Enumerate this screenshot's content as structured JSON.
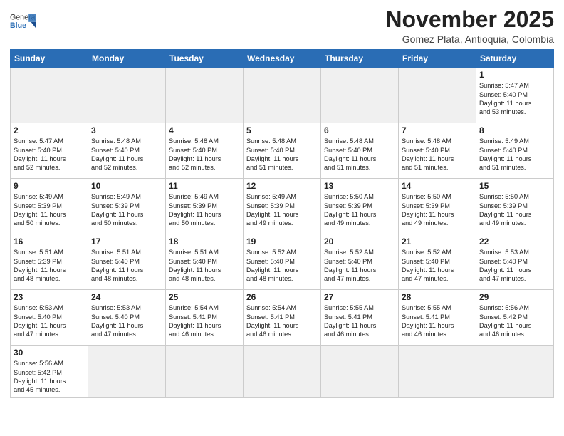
{
  "header": {
    "logo_general": "General",
    "logo_blue": "Blue",
    "month": "November 2025",
    "location": "Gomez Plata, Antioquia, Colombia"
  },
  "weekdays": [
    "Sunday",
    "Monday",
    "Tuesday",
    "Wednesday",
    "Thursday",
    "Friday",
    "Saturday"
  ],
  "weeks": [
    [
      {
        "day": "",
        "info": ""
      },
      {
        "day": "",
        "info": ""
      },
      {
        "day": "",
        "info": ""
      },
      {
        "day": "",
        "info": ""
      },
      {
        "day": "",
        "info": ""
      },
      {
        "day": "",
        "info": ""
      },
      {
        "day": "1",
        "info": "Sunrise: 5:47 AM\nSunset: 5:40 PM\nDaylight: 11 hours\nand 53 minutes."
      }
    ],
    [
      {
        "day": "2",
        "info": "Sunrise: 5:47 AM\nSunset: 5:40 PM\nDaylight: 11 hours\nand 52 minutes."
      },
      {
        "day": "3",
        "info": "Sunrise: 5:48 AM\nSunset: 5:40 PM\nDaylight: 11 hours\nand 52 minutes."
      },
      {
        "day": "4",
        "info": "Sunrise: 5:48 AM\nSunset: 5:40 PM\nDaylight: 11 hours\nand 52 minutes."
      },
      {
        "day": "5",
        "info": "Sunrise: 5:48 AM\nSunset: 5:40 PM\nDaylight: 11 hours\nand 51 minutes."
      },
      {
        "day": "6",
        "info": "Sunrise: 5:48 AM\nSunset: 5:40 PM\nDaylight: 11 hours\nand 51 minutes."
      },
      {
        "day": "7",
        "info": "Sunrise: 5:48 AM\nSunset: 5:40 PM\nDaylight: 11 hours\nand 51 minutes."
      },
      {
        "day": "8",
        "info": "Sunrise: 5:49 AM\nSunset: 5:40 PM\nDaylight: 11 hours\nand 51 minutes."
      }
    ],
    [
      {
        "day": "9",
        "info": "Sunrise: 5:49 AM\nSunset: 5:39 PM\nDaylight: 11 hours\nand 50 minutes."
      },
      {
        "day": "10",
        "info": "Sunrise: 5:49 AM\nSunset: 5:39 PM\nDaylight: 11 hours\nand 50 minutes."
      },
      {
        "day": "11",
        "info": "Sunrise: 5:49 AM\nSunset: 5:39 PM\nDaylight: 11 hours\nand 50 minutes."
      },
      {
        "day": "12",
        "info": "Sunrise: 5:49 AM\nSunset: 5:39 PM\nDaylight: 11 hours\nand 49 minutes."
      },
      {
        "day": "13",
        "info": "Sunrise: 5:50 AM\nSunset: 5:39 PM\nDaylight: 11 hours\nand 49 minutes."
      },
      {
        "day": "14",
        "info": "Sunrise: 5:50 AM\nSunset: 5:39 PM\nDaylight: 11 hours\nand 49 minutes."
      },
      {
        "day": "15",
        "info": "Sunrise: 5:50 AM\nSunset: 5:39 PM\nDaylight: 11 hours\nand 49 minutes."
      }
    ],
    [
      {
        "day": "16",
        "info": "Sunrise: 5:51 AM\nSunset: 5:39 PM\nDaylight: 11 hours\nand 48 minutes."
      },
      {
        "day": "17",
        "info": "Sunrise: 5:51 AM\nSunset: 5:40 PM\nDaylight: 11 hours\nand 48 minutes."
      },
      {
        "day": "18",
        "info": "Sunrise: 5:51 AM\nSunset: 5:40 PM\nDaylight: 11 hours\nand 48 minutes."
      },
      {
        "day": "19",
        "info": "Sunrise: 5:52 AM\nSunset: 5:40 PM\nDaylight: 11 hours\nand 48 minutes."
      },
      {
        "day": "20",
        "info": "Sunrise: 5:52 AM\nSunset: 5:40 PM\nDaylight: 11 hours\nand 47 minutes."
      },
      {
        "day": "21",
        "info": "Sunrise: 5:52 AM\nSunset: 5:40 PM\nDaylight: 11 hours\nand 47 minutes."
      },
      {
        "day": "22",
        "info": "Sunrise: 5:53 AM\nSunset: 5:40 PM\nDaylight: 11 hours\nand 47 minutes."
      }
    ],
    [
      {
        "day": "23",
        "info": "Sunrise: 5:53 AM\nSunset: 5:40 PM\nDaylight: 11 hours\nand 47 minutes."
      },
      {
        "day": "24",
        "info": "Sunrise: 5:53 AM\nSunset: 5:40 PM\nDaylight: 11 hours\nand 47 minutes."
      },
      {
        "day": "25",
        "info": "Sunrise: 5:54 AM\nSunset: 5:41 PM\nDaylight: 11 hours\nand 46 minutes."
      },
      {
        "day": "26",
        "info": "Sunrise: 5:54 AM\nSunset: 5:41 PM\nDaylight: 11 hours\nand 46 minutes."
      },
      {
        "day": "27",
        "info": "Sunrise: 5:55 AM\nSunset: 5:41 PM\nDaylight: 11 hours\nand 46 minutes."
      },
      {
        "day": "28",
        "info": "Sunrise: 5:55 AM\nSunset: 5:41 PM\nDaylight: 11 hours\nand 46 minutes."
      },
      {
        "day": "29",
        "info": "Sunrise: 5:56 AM\nSunset: 5:42 PM\nDaylight: 11 hours\nand 46 minutes."
      }
    ],
    [
      {
        "day": "30",
        "info": "Sunrise: 5:56 AM\nSunset: 5:42 PM\nDaylight: 11 hours\nand 45 minutes."
      },
      {
        "day": "",
        "info": ""
      },
      {
        "day": "",
        "info": ""
      },
      {
        "day": "",
        "info": ""
      },
      {
        "day": "",
        "info": ""
      },
      {
        "day": "",
        "info": ""
      },
      {
        "day": "",
        "info": ""
      }
    ]
  ]
}
